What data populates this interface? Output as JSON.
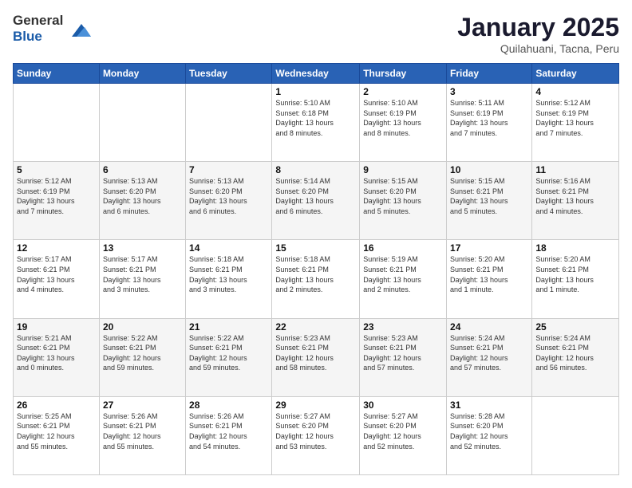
{
  "header": {
    "logo": {
      "line1": "General",
      "line2": "Blue"
    },
    "title": "January 2025",
    "subtitle": "Quilahuani, Tacna, Peru"
  },
  "weekdays": [
    "Sunday",
    "Monday",
    "Tuesday",
    "Wednesday",
    "Thursday",
    "Friday",
    "Saturday"
  ],
  "weeks": [
    [
      {
        "day": "",
        "info": ""
      },
      {
        "day": "",
        "info": ""
      },
      {
        "day": "",
        "info": ""
      },
      {
        "day": "1",
        "info": "Sunrise: 5:10 AM\nSunset: 6:18 PM\nDaylight: 13 hours\nand 8 minutes."
      },
      {
        "day": "2",
        "info": "Sunrise: 5:10 AM\nSunset: 6:19 PM\nDaylight: 13 hours\nand 8 minutes."
      },
      {
        "day": "3",
        "info": "Sunrise: 5:11 AM\nSunset: 6:19 PM\nDaylight: 13 hours\nand 7 minutes."
      },
      {
        "day": "4",
        "info": "Sunrise: 5:12 AM\nSunset: 6:19 PM\nDaylight: 13 hours\nand 7 minutes."
      }
    ],
    [
      {
        "day": "5",
        "info": "Sunrise: 5:12 AM\nSunset: 6:19 PM\nDaylight: 13 hours\nand 7 minutes."
      },
      {
        "day": "6",
        "info": "Sunrise: 5:13 AM\nSunset: 6:20 PM\nDaylight: 13 hours\nand 6 minutes."
      },
      {
        "day": "7",
        "info": "Sunrise: 5:13 AM\nSunset: 6:20 PM\nDaylight: 13 hours\nand 6 minutes."
      },
      {
        "day": "8",
        "info": "Sunrise: 5:14 AM\nSunset: 6:20 PM\nDaylight: 13 hours\nand 6 minutes."
      },
      {
        "day": "9",
        "info": "Sunrise: 5:15 AM\nSunset: 6:20 PM\nDaylight: 13 hours\nand 5 minutes."
      },
      {
        "day": "10",
        "info": "Sunrise: 5:15 AM\nSunset: 6:21 PM\nDaylight: 13 hours\nand 5 minutes."
      },
      {
        "day": "11",
        "info": "Sunrise: 5:16 AM\nSunset: 6:21 PM\nDaylight: 13 hours\nand 4 minutes."
      }
    ],
    [
      {
        "day": "12",
        "info": "Sunrise: 5:17 AM\nSunset: 6:21 PM\nDaylight: 13 hours\nand 4 minutes."
      },
      {
        "day": "13",
        "info": "Sunrise: 5:17 AM\nSunset: 6:21 PM\nDaylight: 13 hours\nand 3 minutes."
      },
      {
        "day": "14",
        "info": "Sunrise: 5:18 AM\nSunset: 6:21 PM\nDaylight: 13 hours\nand 3 minutes."
      },
      {
        "day": "15",
        "info": "Sunrise: 5:18 AM\nSunset: 6:21 PM\nDaylight: 13 hours\nand 2 minutes."
      },
      {
        "day": "16",
        "info": "Sunrise: 5:19 AM\nSunset: 6:21 PM\nDaylight: 13 hours\nand 2 minutes."
      },
      {
        "day": "17",
        "info": "Sunrise: 5:20 AM\nSunset: 6:21 PM\nDaylight: 13 hours\nand 1 minute."
      },
      {
        "day": "18",
        "info": "Sunrise: 5:20 AM\nSunset: 6:21 PM\nDaylight: 13 hours\nand 1 minute."
      }
    ],
    [
      {
        "day": "19",
        "info": "Sunrise: 5:21 AM\nSunset: 6:21 PM\nDaylight: 13 hours\nand 0 minutes."
      },
      {
        "day": "20",
        "info": "Sunrise: 5:22 AM\nSunset: 6:21 PM\nDaylight: 12 hours\nand 59 minutes."
      },
      {
        "day": "21",
        "info": "Sunrise: 5:22 AM\nSunset: 6:21 PM\nDaylight: 12 hours\nand 59 minutes."
      },
      {
        "day": "22",
        "info": "Sunrise: 5:23 AM\nSunset: 6:21 PM\nDaylight: 12 hours\nand 58 minutes."
      },
      {
        "day": "23",
        "info": "Sunrise: 5:23 AM\nSunset: 6:21 PM\nDaylight: 12 hours\nand 57 minutes."
      },
      {
        "day": "24",
        "info": "Sunrise: 5:24 AM\nSunset: 6:21 PM\nDaylight: 12 hours\nand 57 minutes."
      },
      {
        "day": "25",
        "info": "Sunrise: 5:24 AM\nSunset: 6:21 PM\nDaylight: 12 hours\nand 56 minutes."
      }
    ],
    [
      {
        "day": "26",
        "info": "Sunrise: 5:25 AM\nSunset: 6:21 PM\nDaylight: 12 hours\nand 55 minutes."
      },
      {
        "day": "27",
        "info": "Sunrise: 5:26 AM\nSunset: 6:21 PM\nDaylight: 12 hours\nand 55 minutes."
      },
      {
        "day": "28",
        "info": "Sunrise: 5:26 AM\nSunset: 6:21 PM\nDaylight: 12 hours\nand 54 minutes."
      },
      {
        "day": "29",
        "info": "Sunrise: 5:27 AM\nSunset: 6:20 PM\nDaylight: 12 hours\nand 53 minutes."
      },
      {
        "day": "30",
        "info": "Sunrise: 5:27 AM\nSunset: 6:20 PM\nDaylight: 12 hours\nand 52 minutes."
      },
      {
        "day": "31",
        "info": "Sunrise: 5:28 AM\nSunset: 6:20 PM\nDaylight: 12 hours\nand 52 minutes."
      },
      {
        "day": "",
        "info": ""
      }
    ]
  ]
}
